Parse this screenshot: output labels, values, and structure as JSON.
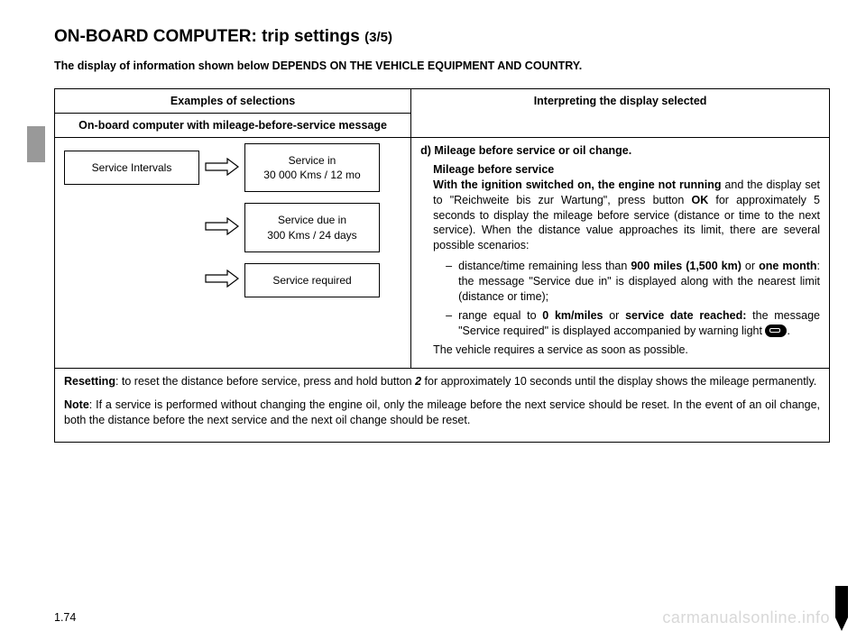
{
  "title_main": "ON-BOARD COMPUTER: trip settings ",
  "title_sub": "(3/5)",
  "intro": "The display of information shown below DEPENDS ON THE VEHICLE EQUIPMENT AND COUNTRY.",
  "table": {
    "header_left_top": "Examples of selections",
    "header_left_bottom": "On-board computer with mileage-before-service message",
    "header_right": "Interpreting the display selected",
    "diagram": {
      "box1": "Service Intervals",
      "box2_l1": "Service in",
      "box2_l2": "30 000 Kms / 12 mo",
      "box3_l1": "Service due in",
      "box3_l2": "300 Kms / 24 days",
      "box4": "Service required"
    },
    "desc": {
      "heading": "d) Mileage before service or oil change.",
      "sub1": "Mileage before service",
      "p1a": "With the ignition switched on, the engine not running",
      "p1b": " and the display set to \"Reichweite bis zur Wartung\", press button ",
      "p1c": "OK",
      "p1d": "  for approximately 5 seconds to display the mileage before service (distance or time to the next service). When the distance value approaches its limit, there are several possible scenarios:",
      "li1a": "distance/time remaining less than ",
      "li1b": "900 miles (1,500 km)",
      "li1c": " or ",
      "li1d": "one month",
      "li1e": ": the message \"Service due in\" is displayed along with the nearest limit (distance or time);",
      "li2a": "range equal to ",
      "li2b": "0 km/miles",
      "li2c": " or ",
      "li2d": "service date reached:",
      "li2e": " the message \"Service required\" is displayed accompanied by warning light ",
      "li2f": ".",
      "p2": "The vehicle requires a service as soon as possible."
    },
    "footer": {
      "reset_label": "Resetting",
      "reset_text": ": to reset the distance before service, press and hold button ",
      "reset_btn": "2",
      "reset_text2": " for approximately 10 seconds until the display shows the mileage permanently.",
      "note_label": "Note",
      "note_text": ": If a service is performed without changing the engine oil, only the mileage before the next service should be reset. In the event of an oil change, both the distance before the next service and the next oil change should be reset."
    }
  },
  "page_number": "1.74",
  "watermark": "carmanualsonline.info"
}
